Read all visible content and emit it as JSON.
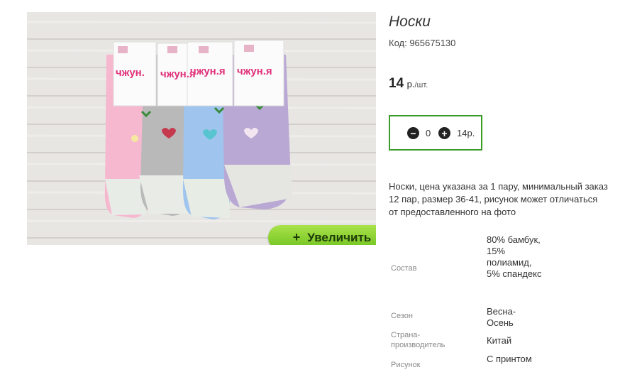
{
  "product": {
    "title": "Носки",
    "code": "Код: 965675130",
    "price_value": "14",
    "price_currency": "р.",
    "price_unit": "/шт.",
    "quantity": "0",
    "total": "14р.",
    "description": "Носки, цена указана за 1 пару, минимальный заказ 12 пар, размер 36-41, рисунок может отличаться от предоставленного на фото",
    "zoom_label": "Увеличить",
    "zoom_icon": "+",
    "image_tags": [
      "чжун.",
      "чжун.я",
      "чжун.я",
      "чжун.я"
    ]
  },
  "specs": [
    {
      "label": "Состав",
      "value": "80% бамбук, 15% полиамид, 5% спандекс"
    },
    {
      "label": "Сезон",
      "value": "Весна-Осень"
    },
    {
      "label": "Страна-производитель",
      "value": "Китай"
    },
    {
      "label": "Рисунок",
      "value": "С принтом"
    }
  ],
  "icons": {
    "minus": "minus-circle-icon",
    "plus": "plus-circle-icon"
  },
  "colors": {
    "accent_green": "#3a9a2a",
    "zoom_button": "#8ed237"
  }
}
